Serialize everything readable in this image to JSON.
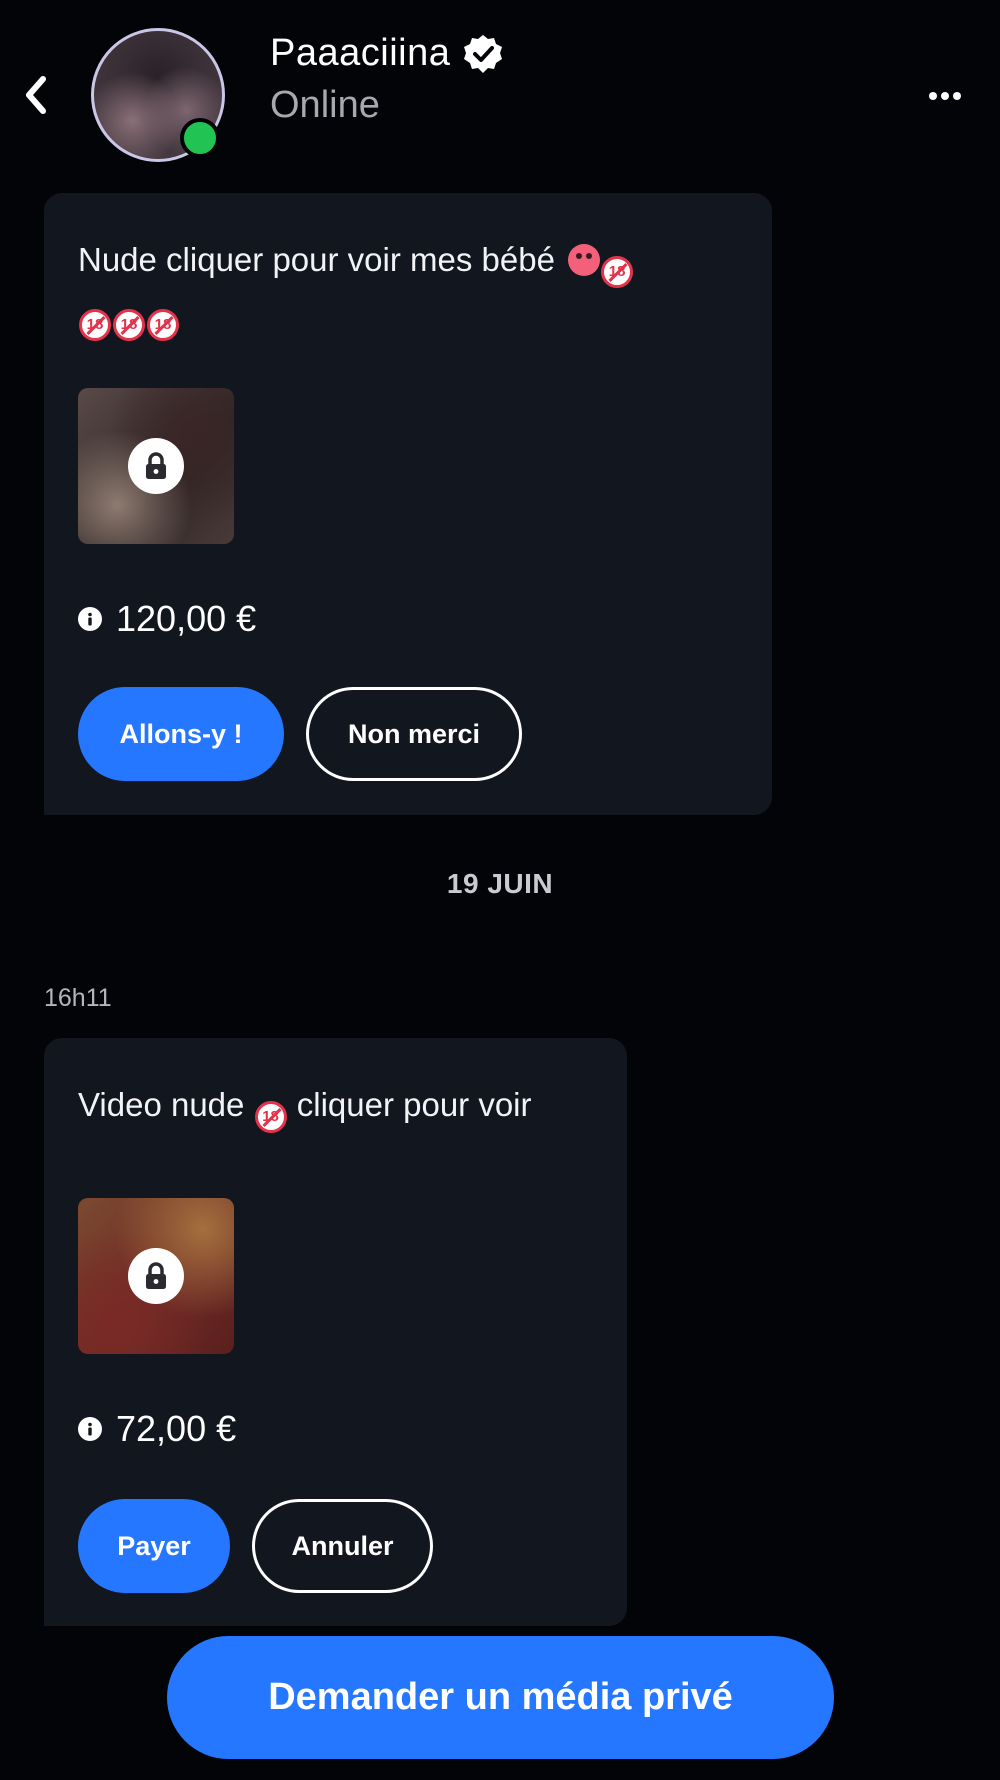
{
  "header": {
    "name": "Paaaciiina",
    "status": "Online",
    "verified": true
  },
  "messages": [
    {
      "text": "Nude cliquer pour voir mes bébé",
      "emojis_after": [
        "devil-emoji",
        "adults-only-emoji",
        "adults-only-emoji",
        "adults-only-emoji",
        "adults-only-emoji"
      ],
      "price": "120,00 €",
      "buttons": {
        "primary": "Allons-y !",
        "secondary": "Non merci"
      }
    },
    {
      "time": "16h11",
      "text_before": "Video nude",
      "text_after": "cliquer pour voir",
      "price": "72,00 €",
      "buttons": {
        "primary": "Payer",
        "secondary": "Annuler"
      }
    }
  ],
  "date_separator": "19 JUIN",
  "cta": {
    "label": "Demander un média privé"
  },
  "emoji_text": {
    "adults_only": "18"
  },
  "colors": {
    "background": "#030407",
    "card": "#12161f",
    "accent": "#2577ff",
    "online": "#21c452",
    "muted": "#a7a9af"
  }
}
